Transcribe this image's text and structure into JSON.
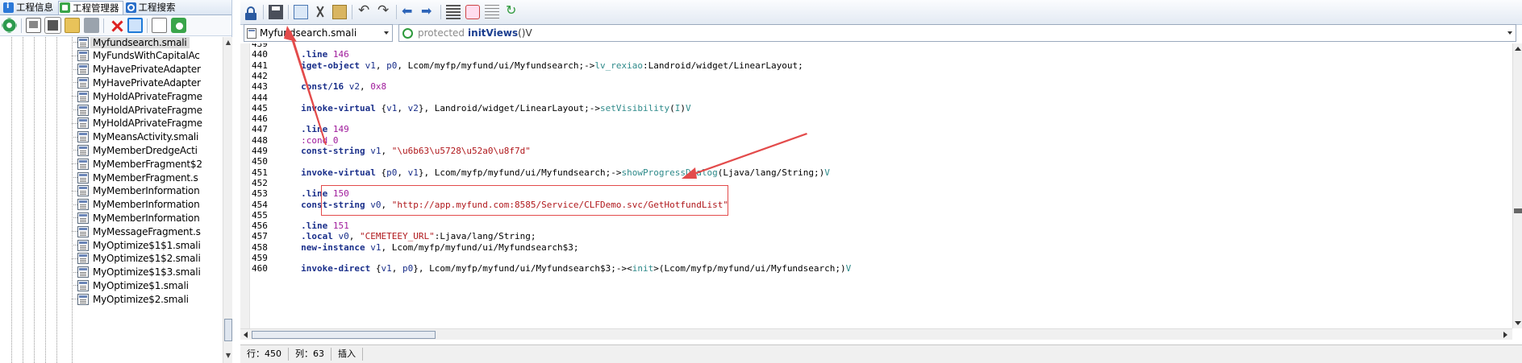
{
  "left_panel": {
    "tabs": [
      {
        "label": "工程信息",
        "icon": "info-icon"
      },
      {
        "label": "工程管理器",
        "icon": "project-manager-icon"
      },
      {
        "label": "工程搜索",
        "icon": "search-icon"
      }
    ],
    "toolbar_icons": [
      "refresh-icon",
      "properties-icon",
      "window-icon",
      "folder-open-icon",
      "bookmark-icon",
      "delete-icon",
      "rename-icon",
      "new-file-icon",
      "android-icon"
    ],
    "tree_items": [
      "Myfundsearch.smali",
      "MyFundsWithCapitalAc",
      "MyHavePrivateAdapter",
      "MyHavePrivateAdapter",
      "MyHoldAPrivateFragme",
      "MyHoldAPrivateFragme",
      "MyHoldAPrivateFragme",
      "MyMeansActivity.smali",
      "MyMemberDredgeActi",
      "MyMemberFragment$2",
      "MyMemberFragment.s",
      "MyMemberInformation",
      "MyMemberInformation",
      "MyMemberInformation",
      "MyMessageFragment.s",
      "MyOptimize$1$1.smali",
      "MyOptimize$1$2.smali",
      "MyOptimize$1$3.smali",
      "MyOptimize$1.smali",
      "MyOptimize$2.smali"
    ],
    "selected_index": 0
  },
  "editor": {
    "toolbar_icons": [
      "lock-icon",
      "save-icon",
      "copy-icon",
      "cut-icon",
      "paste-icon",
      "undo-icon",
      "redo-icon",
      "back-icon",
      "forward-icon",
      "format-icon",
      "java-icon",
      "lines-icon",
      "reload-icon"
    ],
    "file_select": "Myfundsearch.smali",
    "method_select": {
      "modifier": "protected",
      "name": "initViews",
      "signature": "()V"
    },
    "code_lines": [
      {
        "n": "439",
        "parts": []
      },
      {
        "n": "440",
        "parts": [
          [
            "kw",
            ".line "
          ],
          [
            "nm",
            "146"
          ]
        ]
      },
      {
        "n": "441",
        "parts": [
          [
            "kw",
            "iget-object "
          ],
          [
            "rg",
            "v1"
          ],
          [
            "tx",
            ", "
          ],
          [
            "rg",
            "p0"
          ],
          [
            "tx",
            ", Lcom/myfp/myfund/ui/Myfundsearch;->"
          ],
          [
            "fn",
            "lv_rexiao"
          ],
          [
            "tx",
            ":Landroid/widget/LinearLayout;"
          ]
        ]
      },
      {
        "n": "442",
        "parts": []
      },
      {
        "n": "443",
        "parts": [
          [
            "kw",
            "const/16 "
          ],
          [
            "rg",
            "v2"
          ],
          [
            "tx",
            ", "
          ],
          [
            "nm",
            "0x8"
          ]
        ]
      },
      {
        "n": "444",
        "parts": []
      },
      {
        "n": "445",
        "parts": [
          [
            "kw",
            "invoke-virtual "
          ],
          [
            "tx",
            "{"
          ],
          [
            "rg",
            "v1"
          ],
          [
            "tx",
            ", "
          ],
          [
            "rg",
            "v2"
          ],
          [
            "tx",
            "}, Landroid/widget/LinearLayout;->"
          ],
          [
            "fn",
            "setVisibility"
          ],
          [
            "tx",
            "("
          ],
          [
            "fn",
            "I"
          ],
          [
            "tx",
            ")"
          ],
          [
            "fn",
            "V"
          ]
        ]
      },
      {
        "n": "446",
        "parts": []
      },
      {
        "n": "447",
        "parts": [
          [
            "kw",
            ".line "
          ],
          [
            "nm",
            "149"
          ]
        ]
      },
      {
        "n": "448",
        "parts": [
          [
            "nm",
            ":cond_0"
          ]
        ]
      },
      {
        "n": "449",
        "parts": [
          [
            "kw",
            "const-string "
          ],
          [
            "rg",
            "v1"
          ],
          [
            "tx",
            ", "
          ],
          [
            "st",
            "\"\\u6b63\\u5728\\u52a0\\u8f7d\""
          ]
        ]
      },
      {
        "n": "450",
        "parts": []
      },
      {
        "n": "451",
        "parts": [
          [
            "kw",
            "invoke-virtual "
          ],
          [
            "tx",
            "{"
          ],
          [
            "rg",
            "p0"
          ],
          [
            "tx",
            ", "
          ],
          [
            "rg",
            "v1"
          ],
          [
            "tx",
            "}, Lcom/myfp/myfund/ui/Myfundsearch;->"
          ],
          [
            "fn",
            "showProgressDialog"
          ],
          [
            "tx",
            "(Ljava/lang/String;)"
          ],
          [
            "fn",
            "V"
          ]
        ]
      },
      {
        "n": "452",
        "parts": []
      },
      {
        "n": "453",
        "parts": [
          [
            "kw",
            ".line "
          ],
          [
            "nm",
            "150"
          ]
        ]
      },
      {
        "n": "454",
        "parts": [
          [
            "kw",
            "const-string "
          ],
          [
            "rg",
            "v0"
          ],
          [
            "tx",
            ", "
          ],
          [
            "st",
            "\"http://app.myfund.com:8585/Service/CLFDemo.svc/GetHotfundList\""
          ]
        ]
      },
      {
        "n": "455",
        "parts": []
      },
      {
        "n": "456",
        "parts": [
          [
            "kw",
            ".line "
          ],
          [
            "nm",
            "151"
          ]
        ]
      },
      {
        "n": "457",
        "parts": [
          [
            "kw",
            ".local "
          ],
          [
            "rg",
            "v0"
          ],
          [
            "tx",
            ", "
          ],
          [
            "st",
            "\"CEMETEEY_URL\""
          ],
          [
            "tx",
            ":Ljava/lang/String;"
          ]
        ]
      },
      {
        "n": "458",
        "parts": [
          [
            "kw",
            "new-instance "
          ],
          [
            "rg",
            "v1"
          ],
          [
            "tx",
            ", Lcom/myfp/myfund/ui/Myfundsearch$3;"
          ]
        ]
      },
      {
        "n": "459",
        "parts": []
      },
      {
        "n": "460",
        "parts": [
          [
            "kw",
            "invoke-direct "
          ],
          [
            "tx",
            "{"
          ],
          [
            "rg",
            "v1"
          ],
          [
            "tx",
            ", "
          ],
          [
            "rg",
            "p0"
          ],
          [
            "tx",
            "}, Lcom/myfp/myfund/ui/Myfundsearch$3;-><"
          ],
          [
            "fn",
            "init"
          ],
          [
            "tx",
            ">(Lcom/myfp/myfund/ui/Myfundsearch;)"
          ],
          [
            "fn",
            "V"
          ]
        ]
      }
    ]
  },
  "status_bar": {
    "row": "行：450",
    "col": "列：63",
    "mode": "插入"
  },
  "annotation_color": "#e34b4b"
}
